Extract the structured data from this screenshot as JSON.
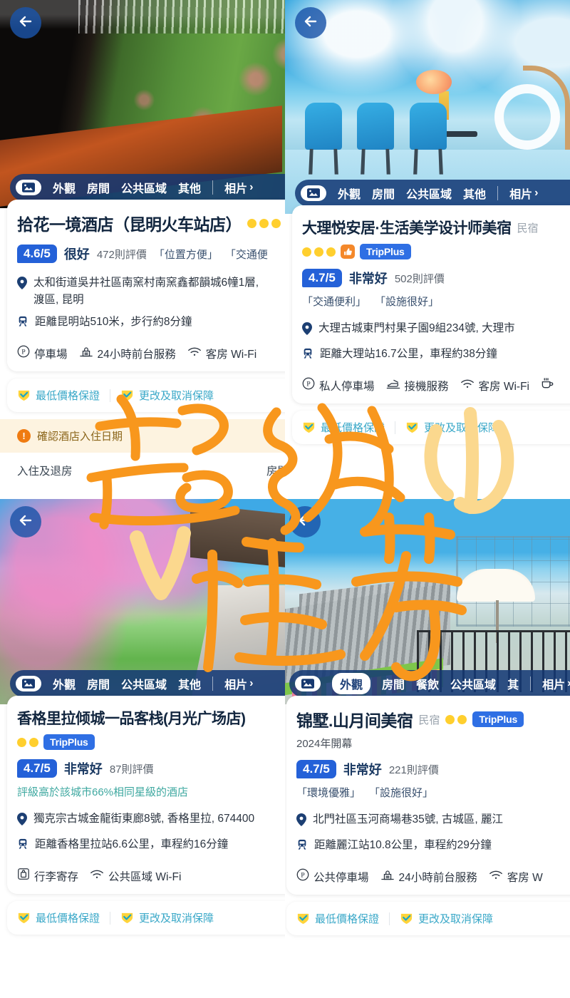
{
  "photo_bar": {
    "thumb_icon": "photo-gallery-icon",
    "categories_a": [
      "外觀",
      "房間",
      "公共區域",
      "其他"
    ],
    "categories_b": [
      "外觀",
      "房間",
      "餐飲",
      "公共區域",
      "其"
    ],
    "more_label": "相片",
    "chevron": "›"
  },
  "back_icon": "back-arrow-icon",
  "panels": [
    {
      "id": "kunming",
      "hotel_name": "拾花一境酒店（昆明火车站店）",
      "hotel_type": "",
      "dot_count": 3,
      "has_thumbup": false,
      "tripplus": "",
      "open_year": "",
      "score": "4.6/5",
      "score_word": "很好",
      "review_count": "472則評價",
      "tags": [
        "「位置方便」",
        "「交通便"
      ],
      "comparison_note": "",
      "address": "太和街道吳井社區南窯村南窯鑫都韻城6幢1層,",
      "address_line2": "渡區, 昆明",
      "transit": "距離昆明站510米，步行約8分鐘",
      "amenities": [
        {
          "icon": "parking-icon",
          "label": "停車場"
        },
        {
          "icon": "front-desk-icon",
          "label": "24小時前台服務"
        },
        {
          "icon": "wifi-icon",
          "label": "客房 Wi-Fi"
        }
      ],
      "guarantees": [
        "最低價格保證",
        "更改及取消保障"
      ],
      "warning": "確認酒店入住日期",
      "subtabs": [
        "入住及退房",
        "房間及住"
      ]
    },
    {
      "id": "dali",
      "hotel_name": "大理悦安居·生活美学设计师美宿",
      "hotel_type": "民宿",
      "dot_count": 3,
      "has_thumbup": true,
      "tripplus": "TripPlus",
      "open_year": "",
      "score": "4.7/5",
      "score_word": "非常好",
      "review_count": "502則評價",
      "tags": [
        "「交通便利」",
        "「設施很好」"
      ],
      "comparison_note": "",
      "address": "大理古城東門村果子園9組234號, 大理市",
      "address_line2": "",
      "transit": "距離大理站16.7公里，車程約38分鐘",
      "amenities": [
        {
          "icon": "parking-icon",
          "label": "私人停車場"
        },
        {
          "icon": "airport-shuttle-icon",
          "label": "接機服務"
        },
        {
          "icon": "wifi-icon",
          "label": "客房 Wi-Fi"
        },
        {
          "icon": "coffee-icon",
          "label": ""
        }
      ],
      "guarantees": [
        "最低價格保證",
        "更改及取消保障"
      ],
      "warning": "",
      "subtabs": []
    },
    {
      "id": "shangrila",
      "hotel_name": "香格里拉倾城一品客栈(月光广场店)",
      "hotel_type": "",
      "dot_count": 2,
      "has_thumbup": false,
      "tripplus": "TripPlus",
      "open_year": "",
      "score": "4.7/5",
      "score_word": "非常好",
      "review_count": "87則評價",
      "tags": [],
      "comparison_note": "評級高於該城市66%相同星級的酒店",
      "address": "獨克宗古城金龍街東廊8號, 香格里拉, 674400",
      "address_line2": "",
      "transit": "距離香格里拉站6.6公里，車程約16分鐘",
      "amenities": [
        {
          "icon": "luggage-storage-icon",
          "label": "行李寄存"
        },
        {
          "icon": "wifi-icon",
          "label": "公共區域 Wi-Fi"
        }
      ],
      "guarantees": [
        "最低價格保證",
        "更改及取消保障"
      ],
      "warning": "",
      "subtabs": []
    },
    {
      "id": "lijiang",
      "hotel_name": "锦墅.山月间美宿",
      "hotel_type": "民宿",
      "dot_count": 2,
      "has_thumbup": false,
      "tripplus": "TripPlus",
      "open_year": "2024年開幕",
      "score": "4.7/5",
      "score_word": "非常好",
      "review_count": "221則評價",
      "tags": [
        "「環境優雅」",
        "「設施很好」"
      ],
      "comparison_note": "",
      "address": "北門社區玉河商場巷35號, 古城區, 麗江",
      "address_line2": "",
      "transit": "距離麗江站10.8公里，車程約29分鐘",
      "amenities": [
        {
          "icon": "parking-icon",
          "label": "公共停車場"
        },
        {
          "icon": "front-desk-icon",
          "label": "24小時前台服務"
        },
        {
          "icon": "wifi-icon",
          "label": "客房 W"
        }
      ],
      "guarantees": [
        "最低價格保證",
        "更改及取消保障"
      ],
      "warning": "",
      "subtabs": []
    }
  ],
  "annotations": [
    {
      "name": "handwriting-super",
      "text": "超級",
      "color": "#f8971d"
    },
    {
      "name": "handwriting-heart",
      "text": "心",
      "color": "#fbd88e"
    },
    {
      "name": "handwriting-recommend",
      "text": "推荐",
      "color": "#f8971d"
    }
  ],
  "colors": {
    "brand_blue": "#2461d8",
    "bar_blue": "#133874",
    "accent_orange": "#f8971d",
    "teal": "#3aa8c8",
    "dot_yellow": "#ffcf2e"
  }
}
